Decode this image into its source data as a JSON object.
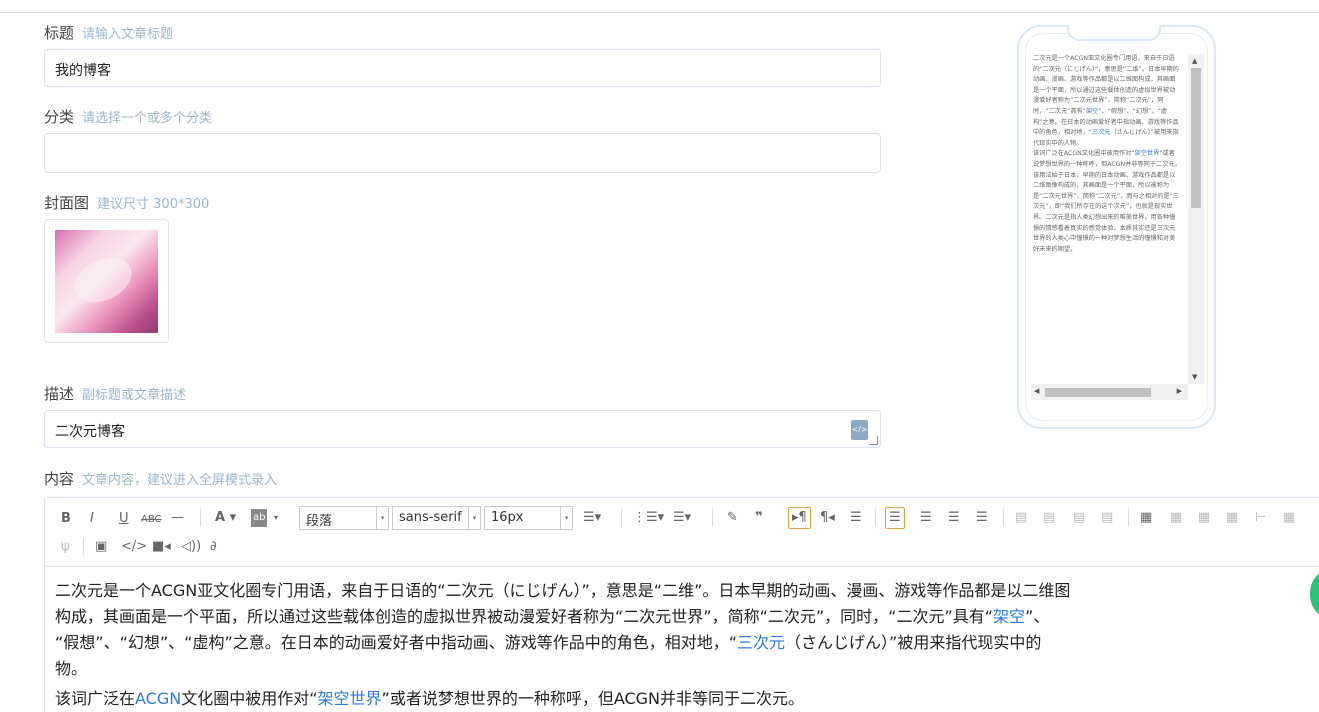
{
  "form": {
    "title_label": "标题",
    "title_hint": "请输入文章标题",
    "title_value": "我的博客",
    "category_label": "分类",
    "category_hint": "请选择一个或多个分类",
    "category_value": "",
    "cover_label": "封面图",
    "cover_hint": "建议尺寸 300*300",
    "desc_label": "描述",
    "desc_hint": "副标题或文章描述",
    "desc_value": "二次元博客",
    "content_label": "内容",
    "content_hint": "文章内容，建议进入全屏模式录入"
  },
  "toolbar": {
    "paragraph": "段落",
    "font": "sans-serif",
    "size": "16px"
  },
  "content": {
    "p1_a": "二次元是一个ACGN亚文化圈专门用语，来自于日语的“二次元（にじげん）”，意思是“二维”。日本早期的动画、漫画、游戏等作品都是以二维图",
    "p1_b": "构成，其画面是一个平面，所以通过这些载体创造的虚拟世界被动漫爱好者称为“二次元世界”，简称“二次元”，同时，“二次元”具有“",
    "p1_link1": "架空",
    "p1_c": "”、",
    "p1_d": "“假想”、“幻想”、“虚构”之意。在日本的动画爱好者中指动画、游戏等作品中的角色，相对地，“",
    "p1_link2": "三次元",
    "p1_e": "（さんじげん）”被用来指代现实中的",
    "p1_f": "物。",
    "p2_a": "该词广泛在",
    "p2_link1": "ACGN",
    "p2_b": "文化圈中被用作对“",
    "p2_link2": "架空世界",
    "p2_c": "”或者说梦想世界的一种称呼，但ACGN并非等同于二次元。"
  },
  "preview": {
    "p1": "二次元是一个ACGN亚文化圈专门用语，来自于日语的“二次元（にじげん）”，意思是“二维”。日本早期的动画、漫画、游戏等作品都是以二维图构成，其画面是一个平面，所以通过这些载体创造的虚拟世界被动漫爱好者称为“二次元世界”，简称“二次元”，同时，“二次元”具有“",
    "p1_link": "架空",
    "p1_b": "”、“假想”、“幻想”、“虚构”之意。在日本的动画爱好者中指动画、游戏等作品中的角色，相对地，“",
    "p1_link2": "三次元",
    "p1_c": "（さんじげん）”被用来指代现实中的人物。",
    "p2": "该词广泛在ACGN文化圈中被用作对“",
    "p2_link": "架空世界",
    "p2_b": "”或者说梦想世界的一种称呼，但ACGN并非等同于二次元。",
    "p3": "该用法始于日本，早期的日本动画、游戏作品都是以二维图像构成的，其画面是一个平面，所以被称为是“二次元世界”，简称“二次元”，而与之相对的是“三次元”，即“我们所存在的这个次元”，也就是现实世界。二次元是指人类幻想出来的唯美世界，用各种憧憬的情感看着真实的感觉体验，本质其实还是三次元世界的人类心中憧憬的一种对梦想生活的憧憬和对美好未来的期望。"
  },
  "colors": {
    "hint": "#9fb5cc",
    "border": "#d7e2ee",
    "link": "#2f7bd6",
    "selected": "#e3a33d"
  }
}
